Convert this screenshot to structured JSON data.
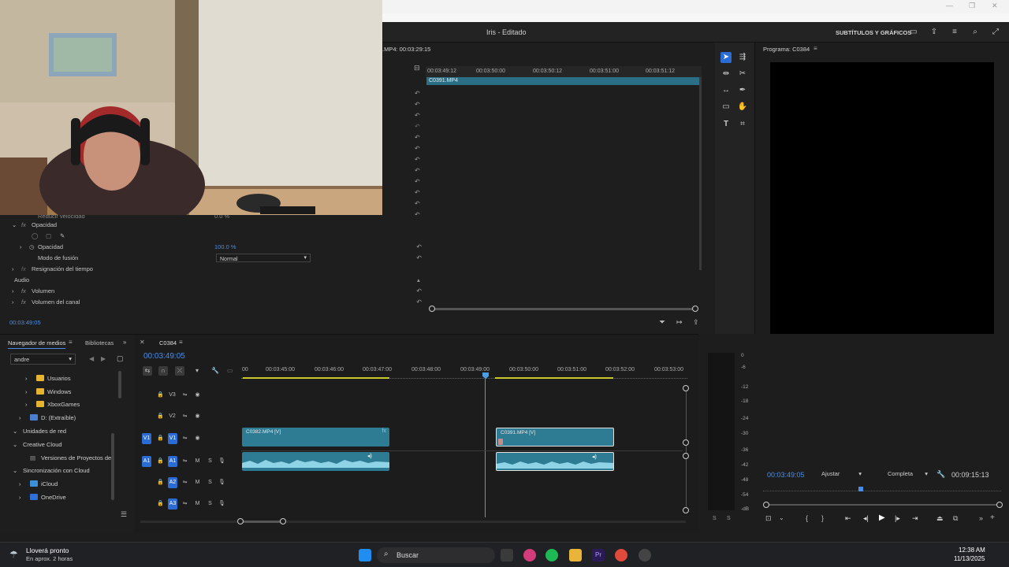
{
  "window": {
    "minimize": "—",
    "restore": "❐",
    "close": "✕"
  },
  "app": {
    "title": "Iris - Editado",
    "captions_label": "SUBTÍTULOS Y GRÁFICOS"
  },
  "effect_controls": {
    "source_time": ".MP4: 00:03:29:15",
    "ruler_ticks": [
      "00:03:49:12",
      "00:03:50:00",
      "00:03:50:12",
      "00:03:51:00",
      "00:03:51:12"
    ],
    "clip_name": "C0391.MP4",
    "rows": {
      "partial_row": "Reducir velocidad",
      "partial_value": "0.0 %",
      "opacity_section": "Opacidad",
      "opacity_label": "Opacidad",
      "opacity_value": "100.0 %",
      "blend_label": "Modo de fusión",
      "blend_value": "Normal",
      "time_remap": "Resignación del tiempo",
      "audio_header": "Audio",
      "volume": "Volumen",
      "channel_volume": "Volumen del canal"
    },
    "timecode": "00:03:49:05"
  },
  "program": {
    "title": "Programa: C0384",
    "timecode": "00:03:49:05",
    "fit": "Ajustar",
    "quality": "Completa",
    "duration": "00:09:15:13"
  },
  "media_browser": {
    "tab_active": "Navegador de medios",
    "tab_libraries": "Bibliotecas",
    "location": "andre",
    "items": [
      {
        "label": "Usuarios",
        "indent": 2
      },
      {
        "label": "Windows",
        "indent": 2
      },
      {
        "label": "XboxGames",
        "indent": 2
      },
      {
        "label": "D: (Extraíble)",
        "indent": 1
      },
      {
        "label": "Unidades de red",
        "indent": 0
      },
      {
        "label": "Creative Cloud",
        "indent": 0
      },
      {
        "label": "Versiones de Proyectos de",
        "indent": 1
      },
      {
        "label": "Sincronización con Cloud",
        "indent": 0
      },
      {
        "label": "iCloud",
        "indent": 1
      },
      {
        "label": "OneDrive",
        "indent": 1
      }
    ]
  },
  "timeline": {
    "sequence": "C0384",
    "timecode": "00:03:49:05",
    "ruler": [
      "00",
      "00:03:45:00",
      "00:03:46:00",
      "00:03:47:00",
      "00:03:48:00",
      "00:03:49:00",
      "00:03:50:00",
      "00:03:51:00",
      "00:03:52:00",
      "00:03:53:00"
    ],
    "tracks": {
      "v3": "V3",
      "v2": "V2",
      "v1": "V1",
      "v1src": "V1",
      "a1": "A1",
      "a1src": "A1",
      "a2": "A2",
      "a3": "A3",
      "mute": "M",
      "solo": "S"
    },
    "clips": {
      "clip1_video": "C0382.MP4 [V]",
      "clip2_video": "C0391.MP4 [V]"
    }
  },
  "meters": {
    "scale": [
      "0",
      "-6",
      "-12",
      "-18",
      "-24",
      "-30",
      "-36",
      "-42",
      "-48",
      "-54",
      "-dB"
    ],
    "solo_l": "S",
    "solo_r": "S"
  },
  "taskbar": {
    "weather_title": "Lloverá pronto",
    "weather_sub": "En aprox. 2 horas",
    "search": "Buscar",
    "time": "12:38 AM",
    "date": "11/13/2025"
  },
  "colors": {
    "accent": "#2b6cd4",
    "clip": "#2d7c93",
    "playhead": "#4a9ee8"
  }
}
